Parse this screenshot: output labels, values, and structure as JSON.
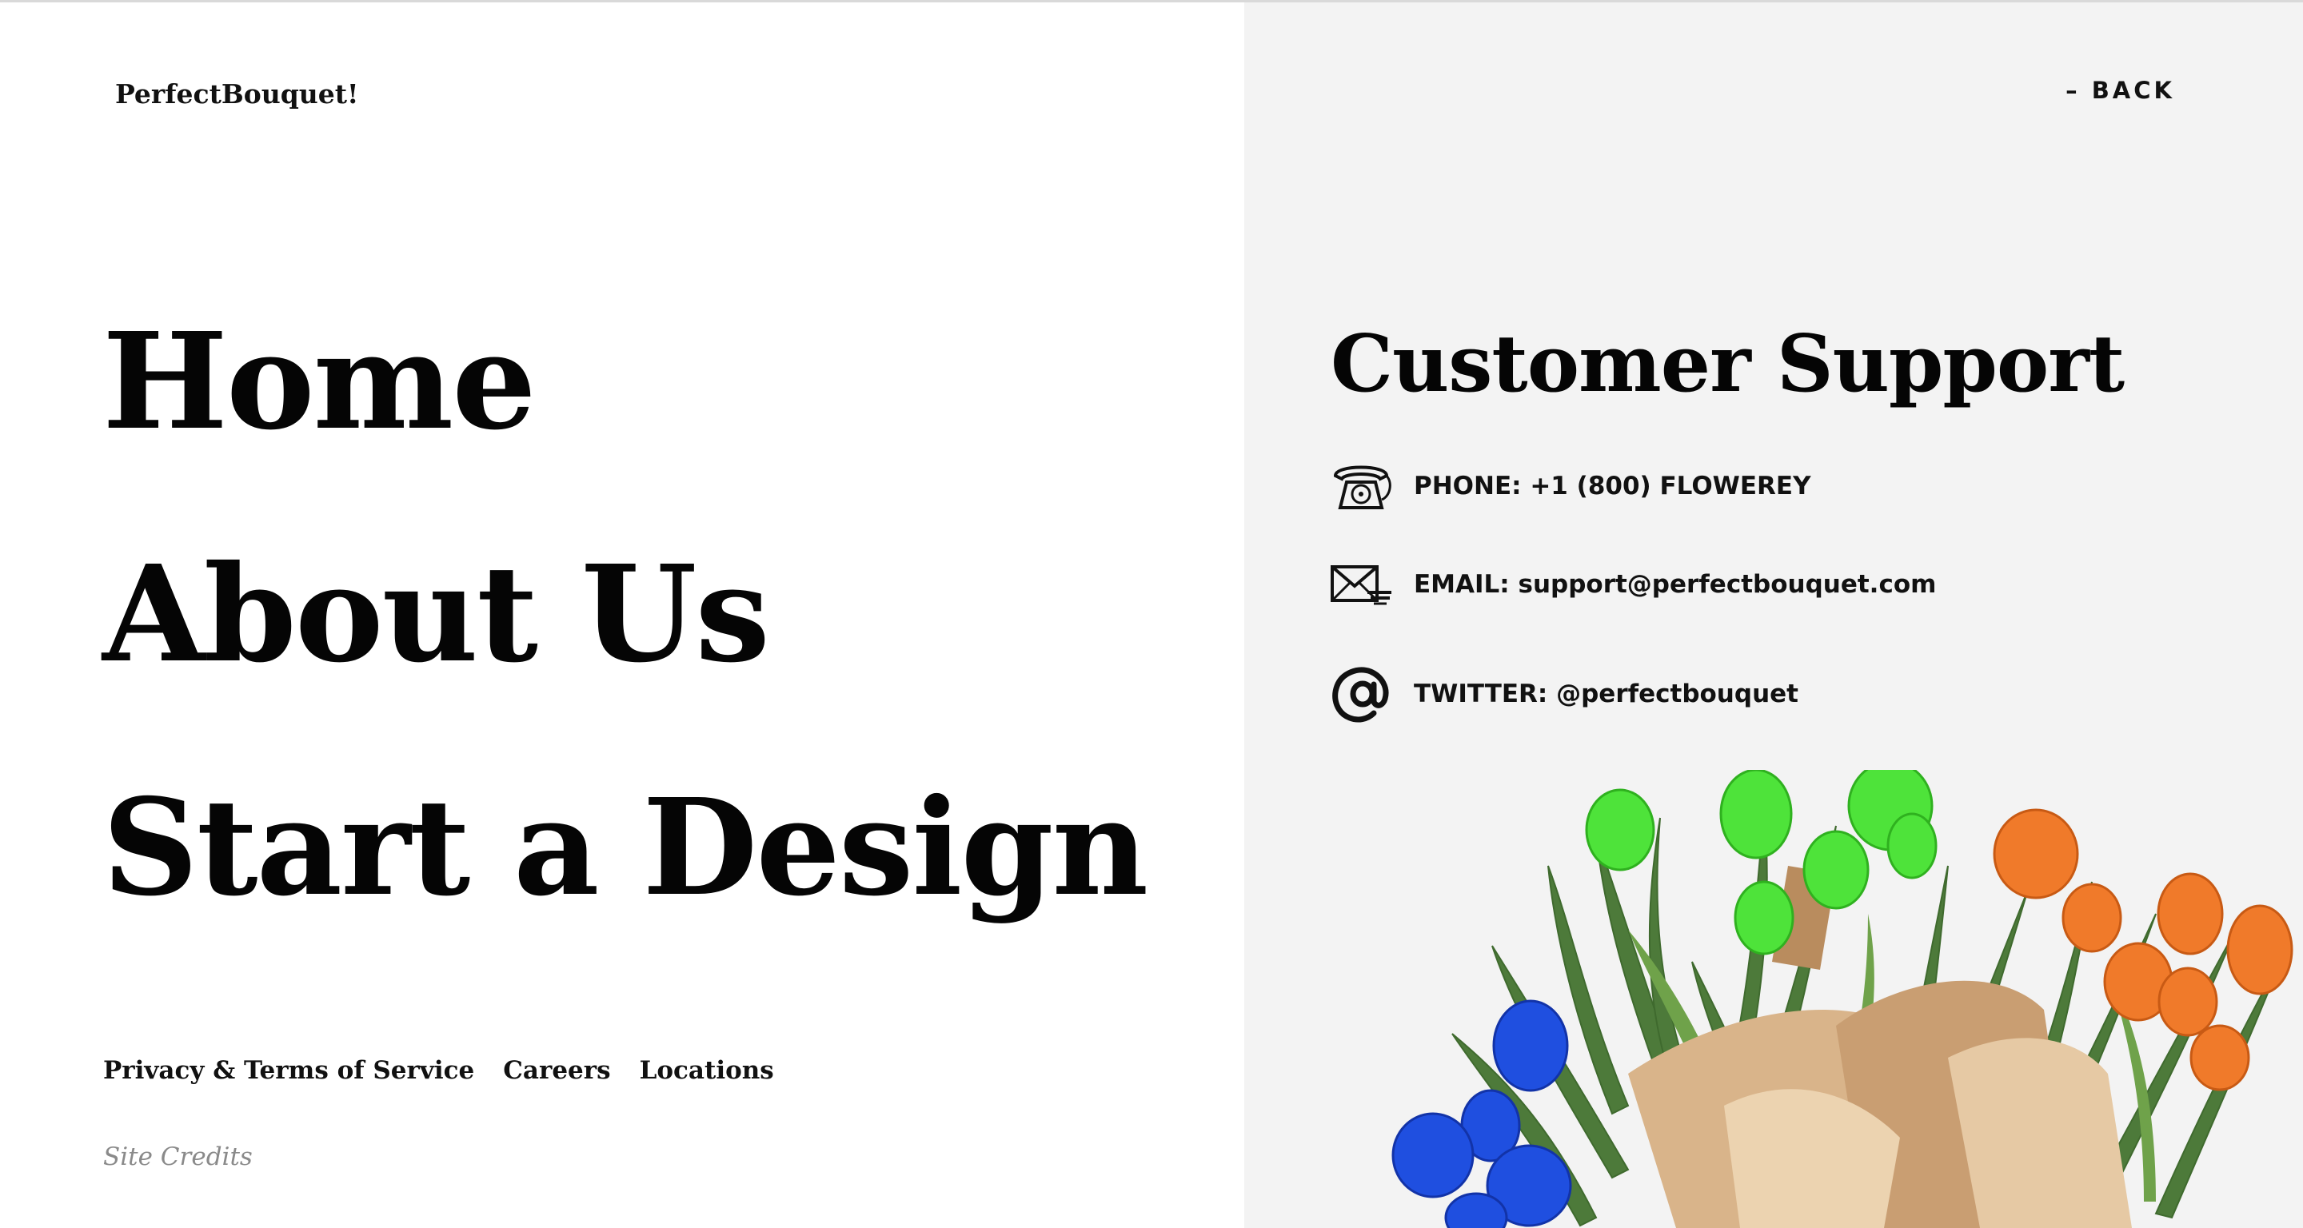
{
  "brand": {
    "name": "PerfectBouquet!"
  },
  "nav": {
    "items": [
      {
        "label": "Home"
      },
      {
        "label": "About Us"
      },
      {
        "label": "Start a Design"
      }
    ]
  },
  "footer": {
    "links": [
      {
        "label": "Privacy & Terms of Service"
      },
      {
        "label": "Careers"
      },
      {
        "label": "Locations"
      }
    ],
    "credits_label": "Site Credits"
  },
  "panel": {
    "back_label": "– BACK",
    "title": "Customer Support",
    "contacts": [
      {
        "icon": "telephone-icon",
        "text": "PHONE: +1 (800) FLOWEREY"
      },
      {
        "icon": "envelope-icon",
        "text": "EMAIL: support@perfectbouquet.com"
      },
      {
        "icon": "at-sign-icon",
        "text": "TWITTER: @perfectbouquet"
      }
    ]
  },
  "colors": {
    "panel_background": "#f3f3f3",
    "text": "#0b0b0b",
    "muted": "#8a8a8a",
    "tulip_green": "#4ee33a",
    "tulip_orange": "#f07a2a",
    "tulip_blue": "#1f4fe0",
    "paper": "#d9b48a"
  }
}
